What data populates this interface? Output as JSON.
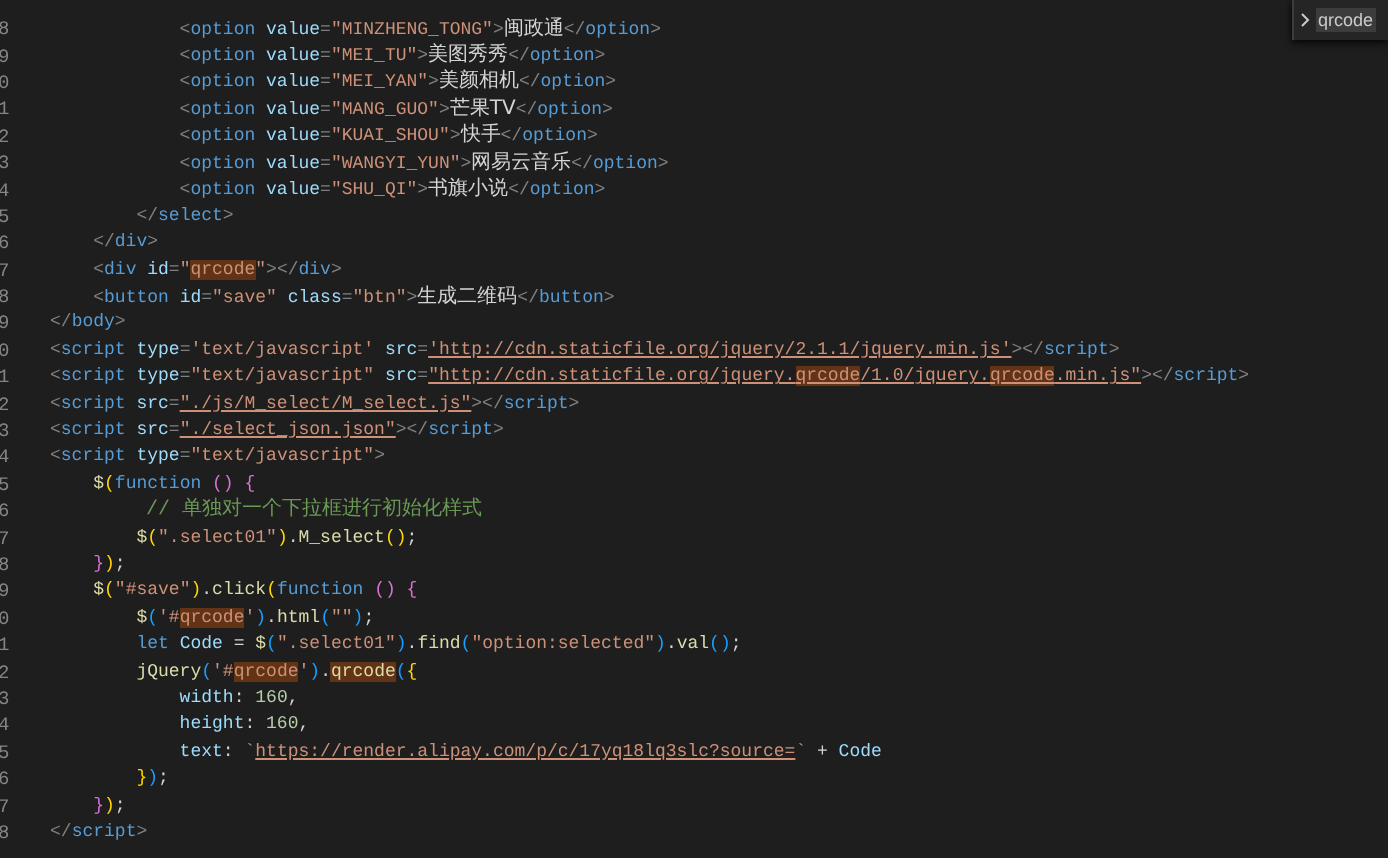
{
  "find_widget": {
    "query": "qrcode"
  },
  "lines": [
    {
      "number": "8",
      "tokens": [
        {
          "kind": "punct",
          "text": "            <"
        },
        {
          "kind": "tag",
          "text": "option"
        },
        {
          "kind": "attr",
          "text": " value"
        },
        {
          "kind": "punct",
          "text": "="
        },
        {
          "kind": "str",
          "text": "\"MINZHENG_TONG\""
        },
        {
          "kind": "punct",
          "text": ">"
        },
        {
          "kind": "text",
          "text": "闽政通"
        },
        {
          "kind": "punct",
          "text": "</"
        },
        {
          "kind": "tag",
          "text": "option"
        },
        {
          "kind": "punct",
          "text": ">"
        }
      ]
    },
    {
      "number": "9",
      "tokens": [
        {
          "kind": "punct",
          "text": "            <"
        },
        {
          "kind": "tag",
          "text": "option"
        },
        {
          "kind": "attr",
          "text": " value"
        },
        {
          "kind": "punct",
          "text": "="
        },
        {
          "kind": "str",
          "text": "\"MEI_TU\""
        },
        {
          "kind": "punct",
          "text": ">"
        },
        {
          "kind": "text",
          "text": "美图秀秀"
        },
        {
          "kind": "punct",
          "text": "</"
        },
        {
          "kind": "tag",
          "text": "option"
        },
        {
          "kind": "punct",
          "text": ">"
        }
      ]
    },
    {
      "number": "0",
      "tokens": [
        {
          "kind": "punct",
          "text": "            <"
        },
        {
          "kind": "tag",
          "text": "option"
        },
        {
          "kind": "attr",
          "text": " value"
        },
        {
          "kind": "punct",
          "text": "="
        },
        {
          "kind": "str",
          "text": "\"MEI_YAN\""
        },
        {
          "kind": "punct",
          "text": ">"
        },
        {
          "kind": "text",
          "text": "美颜相机"
        },
        {
          "kind": "punct",
          "text": "</"
        },
        {
          "kind": "tag",
          "text": "option"
        },
        {
          "kind": "punct",
          "text": ">"
        }
      ]
    },
    {
      "number": "1",
      "tokens": [
        {
          "kind": "punct",
          "text": "            <"
        },
        {
          "kind": "tag",
          "text": "option"
        },
        {
          "kind": "attr",
          "text": " value"
        },
        {
          "kind": "punct",
          "text": "="
        },
        {
          "kind": "str",
          "text": "\"MANG_GUO\""
        },
        {
          "kind": "punct",
          "text": ">"
        },
        {
          "kind": "text",
          "text": "芒果TV"
        },
        {
          "kind": "punct",
          "text": "</"
        },
        {
          "kind": "tag",
          "text": "option"
        },
        {
          "kind": "punct",
          "text": ">"
        }
      ]
    },
    {
      "number": "2",
      "tokens": [
        {
          "kind": "punct",
          "text": "            <"
        },
        {
          "kind": "tag",
          "text": "option"
        },
        {
          "kind": "attr",
          "text": " value"
        },
        {
          "kind": "punct",
          "text": "="
        },
        {
          "kind": "str",
          "text": "\"KUAI_SHOU\""
        },
        {
          "kind": "punct",
          "text": ">"
        },
        {
          "kind": "text",
          "text": "快手"
        },
        {
          "kind": "punct",
          "text": "</"
        },
        {
          "kind": "tag",
          "text": "option"
        },
        {
          "kind": "punct",
          "text": ">"
        }
      ]
    },
    {
      "number": "3",
      "tokens": [
        {
          "kind": "punct",
          "text": "            <"
        },
        {
          "kind": "tag",
          "text": "option"
        },
        {
          "kind": "attr",
          "text": " value"
        },
        {
          "kind": "punct",
          "text": "="
        },
        {
          "kind": "str",
          "text": "\"WANGYI_YUN\""
        },
        {
          "kind": "punct",
          "text": ">"
        },
        {
          "kind": "text",
          "text": "网易云音乐"
        },
        {
          "kind": "punct",
          "text": "</"
        },
        {
          "kind": "tag",
          "text": "option"
        },
        {
          "kind": "punct",
          "text": ">"
        }
      ]
    },
    {
      "number": "4",
      "tokens": [
        {
          "kind": "punct",
          "text": "            <"
        },
        {
          "kind": "tag",
          "text": "option"
        },
        {
          "kind": "attr",
          "text": " value"
        },
        {
          "kind": "punct",
          "text": "="
        },
        {
          "kind": "str",
          "text": "\"SHU_QI\""
        },
        {
          "kind": "punct",
          "text": ">"
        },
        {
          "kind": "text",
          "text": "书旗小说"
        },
        {
          "kind": "punct",
          "text": "</"
        },
        {
          "kind": "tag",
          "text": "option"
        },
        {
          "kind": "punct",
          "text": ">"
        }
      ]
    },
    {
      "number": "5",
      "tokens": [
        {
          "kind": "punct",
          "text": "        </"
        },
        {
          "kind": "tag",
          "text": "select"
        },
        {
          "kind": "punct",
          "text": ">"
        }
      ]
    },
    {
      "number": "6",
      "tokens": [
        {
          "kind": "punct",
          "text": "    </"
        },
        {
          "kind": "tag",
          "text": "div"
        },
        {
          "kind": "punct",
          "text": ">"
        }
      ]
    },
    {
      "number": "7",
      "tokens": [
        {
          "kind": "punct",
          "text": "    <"
        },
        {
          "kind": "tag",
          "text": "div"
        },
        {
          "kind": "attr",
          "text": " id"
        },
        {
          "kind": "punct",
          "text": "="
        },
        {
          "kind": "str",
          "text": "\""
        },
        {
          "kind": "str",
          "text": "qrcode",
          "match": true
        },
        {
          "kind": "str",
          "text": "\""
        },
        {
          "kind": "punct",
          "text": "></"
        },
        {
          "kind": "tag",
          "text": "div"
        },
        {
          "kind": "punct",
          "text": ">"
        }
      ]
    },
    {
      "number": "8",
      "tokens": [
        {
          "kind": "punct",
          "text": "    <"
        },
        {
          "kind": "tag",
          "text": "button"
        },
        {
          "kind": "attr",
          "text": " id"
        },
        {
          "kind": "punct",
          "text": "="
        },
        {
          "kind": "str",
          "text": "\"save\""
        },
        {
          "kind": "attr",
          "text": " class"
        },
        {
          "kind": "punct",
          "text": "="
        },
        {
          "kind": "str",
          "text": "\"btn\""
        },
        {
          "kind": "punct",
          "text": ">"
        },
        {
          "kind": "text",
          "text": "生成二维码"
        },
        {
          "kind": "punct",
          "text": "</"
        },
        {
          "kind": "tag",
          "text": "button"
        },
        {
          "kind": "punct",
          "text": ">"
        }
      ]
    },
    {
      "number": "9",
      "tokens": [
        {
          "kind": "punct",
          "text": "</"
        },
        {
          "kind": "tag",
          "text": "body"
        },
        {
          "kind": "punct",
          "text": ">"
        }
      ]
    },
    {
      "number": "0",
      "tokens": [
        {
          "kind": "punct",
          "text": "<"
        },
        {
          "kind": "tag",
          "text": "script"
        },
        {
          "kind": "attr",
          "text": " type"
        },
        {
          "kind": "punct",
          "text": "="
        },
        {
          "kind": "str",
          "text": "'text/javascript'"
        },
        {
          "kind": "attr",
          "text": " src"
        },
        {
          "kind": "punct",
          "text": "="
        },
        {
          "kind": "str",
          "text": "'http://cdn.staticfile.org/jquery/2.1.1/jquery.min.js'",
          "link": true
        },
        {
          "kind": "punct",
          "text": "></"
        },
        {
          "kind": "tag",
          "text": "script"
        },
        {
          "kind": "punct",
          "text": ">"
        }
      ]
    },
    {
      "number": "1",
      "tokens": [
        {
          "kind": "punct",
          "text": "<"
        },
        {
          "kind": "tag",
          "text": "script"
        },
        {
          "kind": "attr",
          "text": " type"
        },
        {
          "kind": "punct",
          "text": "="
        },
        {
          "kind": "str",
          "text": "\"text/javascript\""
        },
        {
          "kind": "attr",
          "text": " src"
        },
        {
          "kind": "punct",
          "text": "="
        },
        {
          "kind": "str",
          "text": "\"http://cdn.staticfile.org/jquery.",
          "link": true
        },
        {
          "kind": "str",
          "text": "qrcode",
          "match": true,
          "link": true
        },
        {
          "kind": "str",
          "text": "/1.0/jquery.",
          "link": true
        },
        {
          "kind": "str",
          "text": "qrcode",
          "match": true,
          "link": true
        },
        {
          "kind": "str",
          "text": ".min.js\"",
          "link": true
        },
        {
          "kind": "punct",
          "text": "></"
        },
        {
          "kind": "tag",
          "text": "script"
        },
        {
          "kind": "punct",
          "text": ">"
        }
      ]
    },
    {
      "number": "2",
      "tokens": [
        {
          "kind": "punct",
          "text": "<"
        },
        {
          "kind": "tag",
          "text": "script"
        },
        {
          "kind": "attr",
          "text": " src"
        },
        {
          "kind": "punct",
          "text": "="
        },
        {
          "kind": "str",
          "text": "\"./js/M_select/M_select.js\"",
          "link": true
        },
        {
          "kind": "punct",
          "text": "></"
        },
        {
          "kind": "tag",
          "text": "script"
        },
        {
          "kind": "punct",
          "text": ">"
        }
      ]
    },
    {
      "number": "3",
      "tokens": [
        {
          "kind": "punct",
          "text": "<"
        },
        {
          "kind": "tag",
          "text": "script"
        },
        {
          "kind": "attr",
          "text": " src"
        },
        {
          "kind": "punct",
          "text": "="
        },
        {
          "kind": "str",
          "text": "\"./select_json.json\"",
          "link": true
        },
        {
          "kind": "punct",
          "text": "></"
        },
        {
          "kind": "tag",
          "text": "script"
        },
        {
          "kind": "punct",
          "text": ">"
        }
      ]
    },
    {
      "number": "4",
      "tokens": [
        {
          "kind": "punct",
          "text": "<"
        },
        {
          "kind": "tag",
          "text": "script"
        },
        {
          "kind": "attr",
          "text": " type"
        },
        {
          "kind": "punct",
          "text": "="
        },
        {
          "kind": "str",
          "text": "\"text/javascript\""
        },
        {
          "kind": "punct",
          "text": ">"
        }
      ]
    },
    {
      "number": "5",
      "tokens": [
        {
          "kind": "fn",
          "text": "    $"
        },
        {
          "kind": "b1",
          "text": "("
        },
        {
          "kind": "kw",
          "text": "function "
        },
        {
          "kind": "b2",
          "text": "() {"
        }
      ]
    },
    {
      "number": "6",
      "tokens": [
        {
          "kind": "comment",
          "text": "        // 单独对一个下拉框进行初始化样式"
        }
      ]
    },
    {
      "number": "7",
      "tokens": [
        {
          "kind": "fn",
          "text": "        $"
        },
        {
          "kind": "b1",
          "text": "("
        },
        {
          "kind": "str",
          "text": "\".select01\""
        },
        {
          "kind": "b1",
          "text": ")"
        },
        {
          "kind": "plain",
          "text": "."
        },
        {
          "kind": "fn",
          "text": "M_select"
        },
        {
          "kind": "b1",
          "text": "()"
        },
        {
          "kind": "plain",
          "text": ";"
        }
      ]
    },
    {
      "number": "8",
      "tokens": [
        {
          "kind": "b2",
          "text": "    }"
        },
        {
          "kind": "b1",
          "text": ")"
        },
        {
          "kind": "plain",
          "text": ";"
        }
      ]
    },
    {
      "number": "9",
      "tokens": [
        {
          "kind": "fn",
          "text": "    $"
        },
        {
          "kind": "b1",
          "text": "("
        },
        {
          "kind": "str",
          "text": "\"#save\""
        },
        {
          "kind": "b1",
          "text": ")"
        },
        {
          "kind": "plain",
          "text": "."
        },
        {
          "kind": "fn",
          "text": "click"
        },
        {
          "kind": "b1",
          "text": "("
        },
        {
          "kind": "kw",
          "text": "function "
        },
        {
          "kind": "b2",
          "text": "() {"
        }
      ]
    },
    {
      "number": "0",
      "tokens": [
        {
          "kind": "fn",
          "text": "        $"
        },
        {
          "kind": "b3",
          "text": "("
        },
        {
          "kind": "str",
          "text": "'#"
        },
        {
          "kind": "str",
          "text": "qrcode",
          "match": true
        },
        {
          "kind": "str",
          "text": "'"
        },
        {
          "kind": "b3",
          "text": ")"
        },
        {
          "kind": "plain",
          "text": "."
        },
        {
          "kind": "fn",
          "text": "html"
        },
        {
          "kind": "b3",
          "text": "("
        },
        {
          "kind": "str",
          "text": "\"\""
        },
        {
          "kind": "b3",
          "text": ")"
        },
        {
          "kind": "plain",
          "text": ";"
        }
      ]
    },
    {
      "number": "1",
      "tokens": [
        {
          "kind": "kw",
          "text": "        let"
        },
        {
          "kind": "var",
          "text": " Code"
        },
        {
          "kind": "plain",
          "text": " = "
        },
        {
          "kind": "fn",
          "text": "$"
        },
        {
          "kind": "b3",
          "text": "("
        },
        {
          "kind": "str",
          "text": "\".select01\""
        },
        {
          "kind": "b3",
          "text": ")"
        },
        {
          "kind": "plain",
          "text": "."
        },
        {
          "kind": "fn",
          "text": "find"
        },
        {
          "kind": "b3",
          "text": "("
        },
        {
          "kind": "str",
          "text": "\"option:selected\""
        },
        {
          "kind": "b3",
          "text": ")"
        },
        {
          "kind": "plain",
          "text": "."
        },
        {
          "kind": "fn",
          "text": "val"
        },
        {
          "kind": "b3",
          "text": "()"
        },
        {
          "kind": "plain",
          "text": ";"
        }
      ]
    },
    {
      "number": "2",
      "tokens": [
        {
          "kind": "fn",
          "text": "        jQuery"
        },
        {
          "kind": "b3",
          "text": "("
        },
        {
          "kind": "str",
          "text": "'#"
        },
        {
          "kind": "str",
          "text": "qrcode",
          "match": true
        },
        {
          "kind": "str",
          "text": "'"
        },
        {
          "kind": "b3",
          "text": ")"
        },
        {
          "kind": "plain",
          "text": "."
        },
        {
          "kind": "fn",
          "text": "qrcode",
          "match": true
        },
        {
          "kind": "b3",
          "text": "("
        },
        {
          "kind": "b1",
          "text": "{"
        }
      ]
    },
    {
      "number": "3",
      "tokens": [
        {
          "kind": "var",
          "text": "            width"
        },
        {
          "kind": "plain",
          "text": ": "
        },
        {
          "kind": "num",
          "text": "160"
        },
        {
          "kind": "plain",
          "text": ","
        }
      ]
    },
    {
      "number": "4",
      "tokens": [
        {
          "kind": "var",
          "text": "            height"
        },
        {
          "kind": "plain",
          "text": ": "
        },
        {
          "kind": "num",
          "text": "160"
        },
        {
          "kind": "plain",
          "text": ","
        }
      ]
    },
    {
      "number": "5",
      "tokens": [
        {
          "kind": "var",
          "text": "            text"
        },
        {
          "kind": "plain",
          "text": ": "
        },
        {
          "kind": "str",
          "text": "`"
        },
        {
          "kind": "str",
          "text": "https://render.alipay.com/p/c/17yq18lq3slc?source=",
          "link": true
        },
        {
          "kind": "str",
          "text": "`"
        },
        {
          "kind": "plain",
          "text": " + "
        },
        {
          "kind": "var",
          "text": "Code"
        }
      ]
    },
    {
      "number": "6",
      "tokens": [
        {
          "kind": "b1",
          "text": "        }"
        },
        {
          "kind": "b3",
          "text": ")"
        },
        {
          "kind": "plain",
          "text": ";"
        }
      ]
    },
    {
      "number": "7",
      "tokens": [
        {
          "kind": "b2",
          "text": "    }"
        },
        {
          "kind": "b1",
          "text": ")"
        },
        {
          "kind": "plain",
          "text": ";"
        }
      ]
    },
    {
      "number": "8",
      "tokens": [
        {
          "kind": "punct",
          "text": "</"
        },
        {
          "kind": "tag",
          "text": "script"
        },
        {
          "kind": "punct",
          "text": ">"
        }
      ]
    }
  ]
}
